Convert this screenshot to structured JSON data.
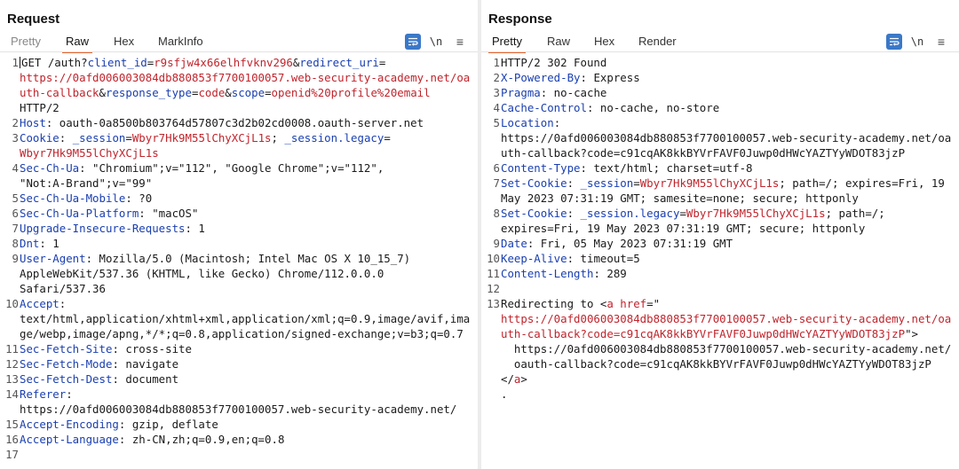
{
  "layout_toggle": {
    "options": [
      "side-by-side",
      "horizontal",
      "vertical"
    ],
    "selected": "side-by-side"
  },
  "request": {
    "title": "Request",
    "tabs": [
      "Pretty",
      "Raw",
      "Hex",
      "MarkInfo"
    ],
    "active_tab": "Raw",
    "newline_label": "\\n",
    "lines": [
      {
        "n": "1",
        "t": "GET /auth?client_id=r9sfjw4x66elhfvknv296&redirect_uri="
      },
      {
        "n": "",
        "t": "https://0afd006003084db880853f7700100057.web-security-academy.net/oa"
      },
      {
        "n": "",
        "t": "uth-callback&response_type=code&scope=openid%20profile%20email"
      },
      {
        "n": "",
        "t": "HTTP/2"
      },
      {
        "n": "2",
        "t": "Host: oauth-0a8500b803764d57807c3d2b02cd0008.oauth-server.net"
      },
      {
        "n": "3",
        "t": "Cookie: _session=Wbyr7Hk9M55lChyXCjL1s; _session.legacy="
      },
      {
        "n": "",
        "t": "Wbyr7Hk9M55lChyXCjL1s"
      },
      {
        "n": "4",
        "t": "Sec-Ch-Ua: \"Chromium\";v=\"112\", \"Google Chrome\";v=\"112\","
      },
      {
        "n": "",
        "t": "\"Not:A-Brand\";v=\"99\""
      },
      {
        "n": "5",
        "t": "Sec-Ch-Ua-Mobile: ?0"
      },
      {
        "n": "6",
        "t": "Sec-Ch-Ua-Platform: \"macOS\""
      },
      {
        "n": "7",
        "t": "Upgrade-Insecure-Requests: 1"
      },
      {
        "n": "8",
        "t": "Dnt: 1"
      },
      {
        "n": "9",
        "t": "User-Agent: Mozilla/5.0 (Macintosh; Intel Mac OS X 10_15_7)"
      },
      {
        "n": "",
        "t": "AppleWebKit/537.36 (KHTML, like Gecko) Chrome/112.0.0.0"
      },
      {
        "n": "",
        "t": "Safari/537.36"
      },
      {
        "n": "10",
        "t": "Accept:"
      },
      {
        "n": "",
        "t": "text/html,application/xhtml+xml,application/xml;q=0.9,image/avif,ima"
      },
      {
        "n": "",
        "t": "ge/webp,image/apng,*/*;q=0.8,application/signed-exchange;v=b3;q=0.7"
      },
      {
        "n": "11",
        "t": "Sec-Fetch-Site: cross-site"
      },
      {
        "n": "12",
        "t": "Sec-Fetch-Mode: navigate"
      },
      {
        "n": "13",
        "t": "Sec-Fetch-Dest: document"
      },
      {
        "n": "14",
        "t": "Referer:"
      },
      {
        "n": "",
        "t": "https://0afd006003084db880853f7700100057.web-security-academy.net/"
      },
      {
        "n": "15",
        "t": "Accept-Encoding: gzip, deflate"
      },
      {
        "n": "16",
        "t": "Accept-Language: zh-CN,zh;q=0.9,en;q=0.8"
      },
      {
        "n": "17",
        "t": ""
      }
    ]
  },
  "response": {
    "title": "Response",
    "tabs": [
      "Pretty",
      "Raw",
      "Hex",
      "Render"
    ],
    "active_tab": "Pretty",
    "newline_label": "\\n",
    "lines": [
      {
        "n": "1",
        "t": "HTTP/2 302 Found"
      },
      {
        "n": "2",
        "t": "X-Powered-By: Express"
      },
      {
        "n": "3",
        "t": "Pragma: no-cache"
      },
      {
        "n": "4",
        "t": "Cache-Control: no-cache, no-store"
      },
      {
        "n": "5",
        "t": "Location:"
      },
      {
        "n": "",
        "t": "https://0afd006003084db880853f7700100057.web-security-academy.net/oa"
      },
      {
        "n": "",
        "t": "uth-callback?code=c91cqAK8kkBYVrFAVF0Juwp0dHWcYAZTYyWDOT83jzP"
      },
      {
        "n": "6",
        "t": "Content-Type: text/html; charset=utf-8"
      },
      {
        "n": "7",
        "t": "Set-Cookie: _session=Wbyr7Hk9M55lChyXCjL1s; path=/; expires=Fri, 19"
      },
      {
        "n": "",
        "t": "May 2023 07:31:19 GMT; samesite=none; secure; httponly"
      },
      {
        "n": "8",
        "t": "Set-Cookie: _session.legacy=Wbyr7Hk9M55lChyXCjL1s; path=/;"
      },
      {
        "n": "",
        "t": "expires=Fri, 19 May 2023 07:31:19 GMT; secure; httponly"
      },
      {
        "n": "9",
        "t": "Date: Fri, 05 May 2023 07:31:19 GMT"
      },
      {
        "n": "10",
        "t": "Keep-Alive: timeout=5"
      },
      {
        "n": "11",
        "t": "Content-Length: 289"
      },
      {
        "n": "12",
        "t": ""
      },
      {
        "n": "13",
        "t": "Redirecting to <a href=\""
      },
      {
        "n": "",
        "t": "https://0afd006003084db880853f7700100057.web-security-academy.net/oa"
      },
      {
        "n": "",
        "t": "uth-callback?code=c91cqAK8kkBYVrFAVF0Juwp0dHWcYAZTYyWDOT83jzP\">"
      },
      {
        "n": "",
        "t": "  https://0afd006003084db880853f7700100057.web-security-academy.net/"
      },
      {
        "n": "",
        "t": "  oauth-callback?code=c91cqAK8kkBYVrFAVF0Juwp0dHWcYAZTYyWDOT83jzP"
      },
      {
        "n": "",
        "t": "</a>"
      },
      {
        "n": "",
        "t": "."
      }
    ]
  }
}
